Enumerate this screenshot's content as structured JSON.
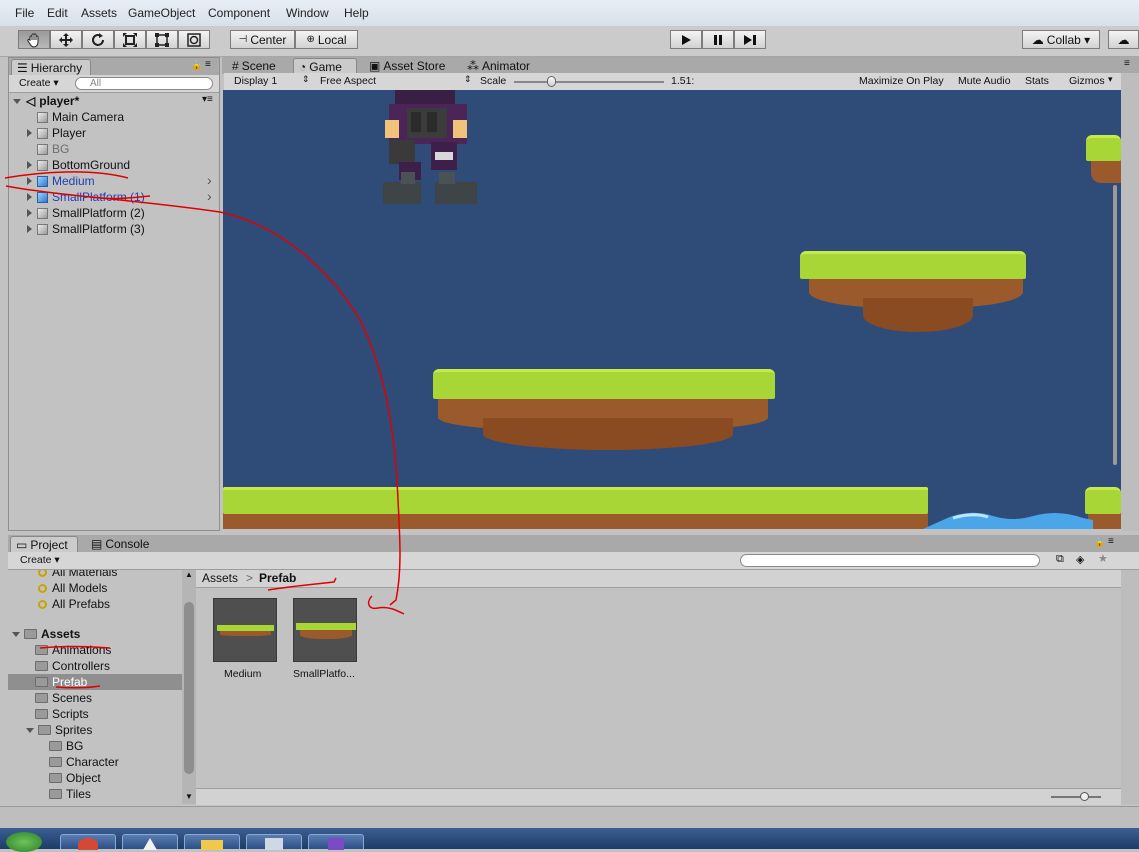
{
  "menu": [
    "File",
    "Edit",
    "Assets",
    "GameObject",
    "Component",
    "Window",
    "Help"
  ],
  "toolbar": {
    "tools": [
      "hand-icon",
      "move-icon",
      "rotate-icon",
      "scale-icon",
      "rect-tool-icon",
      "transform-icon"
    ],
    "center_label": "Center",
    "local_label": "Local",
    "collab_label": "Collab ▾"
  },
  "hierarchy": {
    "tab": "Hierarchy",
    "create": "Create ▾",
    "search_placeholder": "All",
    "scene": "player*",
    "items": [
      {
        "label": "Main Camera",
        "expandable": false,
        "blue": false,
        "dim": false
      },
      {
        "label": "Player",
        "expandable": true,
        "blue": false,
        "dim": false
      },
      {
        "label": "BG",
        "expandable": false,
        "blue": false,
        "dim": true
      },
      {
        "label": "BottomGround",
        "expandable": true,
        "blue": false,
        "dim": false
      },
      {
        "label": "Medium",
        "expandable": true,
        "blue": true,
        "dim": false
      },
      {
        "label": "SmallPlatform (1)",
        "expandable": true,
        "blue": true,
        "dim": false
      },
      {
        "label": "SmallPlatform (2)",
        "expandable": true,
        "blue": false,
        "dim": false
      },
      {
        "label": "SmallPlatform (3)",
        "expandable": true,
        "blue": false,
        "dim": false
      }
    ]
  },
  "center_tabs": {
    "scene": "Scene",
    "game": "Game",
    "asset_store": "Asset Store",
    "animator": "Animator"
  },
  "game_bar": {
    "display": "Display 1",
    "aspect": "Free Aspect",
    "scale_label": "Scale",
    "scale_value": "1.51:",
    "maximize": "Maximize On Play",
    "mute": "Mute Audio",
    "stats": "Stats",
    "gizmos": "Gizmos"
  },
  "bottom_tabs": {
    "project": "Project",
    "console": "Console",
    "create": "Create ▾"
  },
  "project_tree": {
    "favorites": [
      "All Materials",
      "All Models",
      "All Prefabs"
    ],
    "root": "Assets",
    "folders": [
      {
        "label": "Animations",
        "level": 1,
        "selected": false
      },
      {
        "label": "Controllers",
        "level": 1,
        "selected": false
      },
      {
        "label": "Prefab",
        "level": 1,
        "selected": true
      },
      {
        "label": "Scenes",
        "level": 1,
        "selected": false
      },
      {
        "label": "Scripts",
        "level": 1,
        "selected": false
      },
      {
        "label": "Sprites",
        "level": 1,
        "selected": false
      },
      {
        "label": "BG",
        "level": 2,
        "selected": false
      },
      {
        "label": "Character",
        "level": 2,
        "selected": false
      },
      {
        "label": "Object",
        "level": 2,
        "selected": false
      },
      {
        "label": "Tiles",
        "level": 2,
        "selected": false
      }
    ]
  },
  "breadcrumb": {
    "root": "Assets",
    "sep": ">",
    "current": "Prefab"
  },
  "assets": [
    {
      "label": "Medium"
    },
    {
      "label": "SmallPlatfo..."
    }
  ],
  "colors": {
    "game_bg": "#2f4c79",
    "grass": "#a8d636",
    "dirt": "#9a5a2c",
    "annotation": "#e00000",
    "prefab_blue": "#1e3fb5"
  }
}
